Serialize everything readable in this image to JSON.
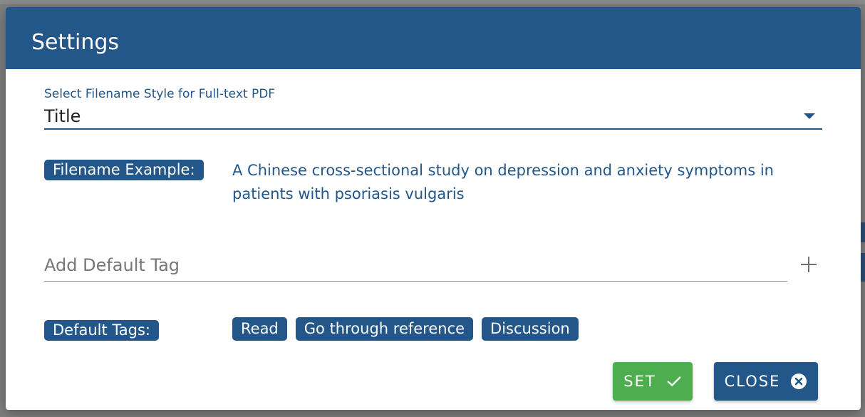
{
  "dialog": {
    "title": "Settings",
    "filename_style": {
      "label": "Select Filename Style for Full-text PDF",
      "value": "Title"
    },
    "filename_example": {
      "label": "Filename Example:",
      "text": "A Chinese cross-sectional study on depression and anxiety symptoms in patients with psoriasis vulgaris"
    },
    "add_tag": {
      "placeholder": "Add Default Tag",
      "value": ""
    },
    "default_tags": {
      "label": "Default Tags:",
      "items": [
        "Read",
        "Go through reference",
        "Discussion"
      ]
    },
    "buttons": {
      "set_label": "SET",
      "close_label": "CLOSE"
    }
  },
  "colors": {
    "primary": "#235689",
    "success": "#4cae4f"
  },
  "icons": {
    "select_caret": "caret-down-icon",
    "add_tag": "plus-icon",
    "set": "check-icon",
    "close": "close-circle-icon"
  }
}
